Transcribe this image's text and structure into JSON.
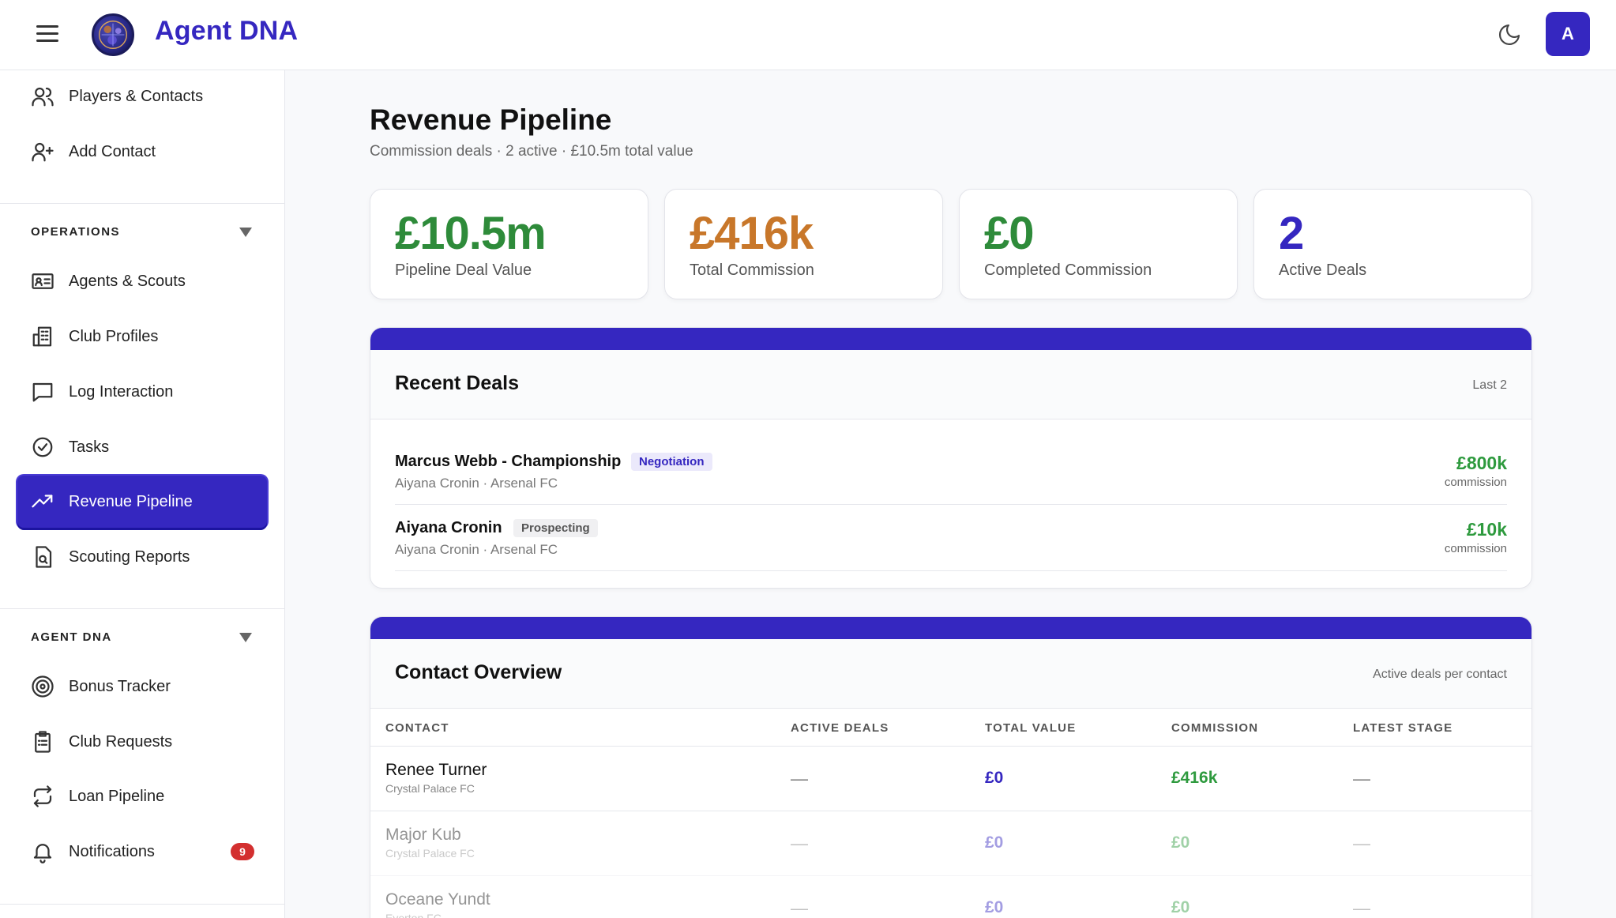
{
  "app": {
    "brand": "Agent DNA",
    "avatar_letter": "A"
  },
  "sidebar": {
    "top_items": [
      {
        "label": "Players & Contacts",
        "icon": "users-icon"
      },
      {
        "label": "Add Contact",
        "icon": "user-plus-icon"
      }
    ],
    "operations": {
      "heading": "OPERATIONS",
      "items": [
        {
          "label": "Agents & Scouts",
          "icon": "id-card-icon"
        },
        {
          "label": "Club Profiles",
          "icon": "building-icon"
        },
        {
          "label": "Log Interaction",
          "icon": "message-icon"
        },
        {
          "label": "Tasks",
          "icon": "check-circle-icon"
        },
        {
          "label": "Revenue Pipeline",
          "icon": "trending-up-icon",
          "active": true
        },
        {
          "label": "Scouting Reports",
          "icon": "file-search-icon"
        }
      ]
    },
    "agent_dna": {
      "heading": "AGENT DNA",
      "items": [
        {
          "label": "Bonus Tracker",
          "icon": "target-icon"
        },
        {
          "label": "Club Requests",
          "icon": "clipboard-icon"
        },
        {
          "label": "Loan Pipeline",
          "icon": "repeat-icon"
        },
        {
          "label": "Notifications",
          "icon": "bell-icon",
          "badge": "9"
        }
      ]
    }
  },
  "page": {
    "title": "Revenue Pipeline",
    "subtitle": "Commission deals · 2 active · £10.5m total value"
  },
  "stats": [
    {
      "value": "£10.5m",
      "label": "Pipeline Deal Value",
      "color": "#2e8b3a"
    },
    {
      "value": "£416k",
      "label": "Total Commission",
      "color": "#c8772a"
    },
    {
      "value": "£0",
      "label": "Completed Commission",
      "color": "#2e8b3a"
    },
    {
      "value": "2",
      "label": "Active Deals",
      "color": "#3527c0"
    }
  ],
  "recent_deals": {
    "title": "Recent Deals",
    "meta": "Last 2",
    "items": [
      {
        "name": "Marcus Webb - Championship",
        "stage": "Negotiation",
        "sub": "Aiyana Cronin · Arsenal FC",
        "amount": "£800k",
        "amount_label": "commission"
      },
      {
        "name": "Aiyana Cronin",
        "stage": "Prospecting",
        "sub": "Aiyana Cronin · Arsenal FC",
        "amount": "£10k",
        "amount_label": "commission"
      }
    ]
  },
  "contact_overview": {
    "title": "Contact Overview",
    "meta": "Active deals per contact",
    "columns": [
      "CONTACT",
      "ACTIVE DEALS",
      "TOTAL VALUE",
      "COMMISSION",
      "LATEST STAGE"
    ],
    "rows": [
      {
        "name": "Renee Turner",
        "club": "Crystal Palace FC",
        "active_deals": "—",
        "total_value": "£0",
        "commission": "£416k",
        "latest_stage": "—"
      },
      {
        "name": "Major Kub",
        "club": "Crystal Palace FC",
        "active_deals": "—",
        "total_value": "£0",
        "commission": "£0",
        "latest_stage": "—"
      },
      {
        "name": "Oceane Yundt",
        "club": "Everton FC",
        "active_deals": "—",
        "total_value": "£0",
        "commission": "£0",
        "latest_stage": "—"
      }
    ]
  }
}
